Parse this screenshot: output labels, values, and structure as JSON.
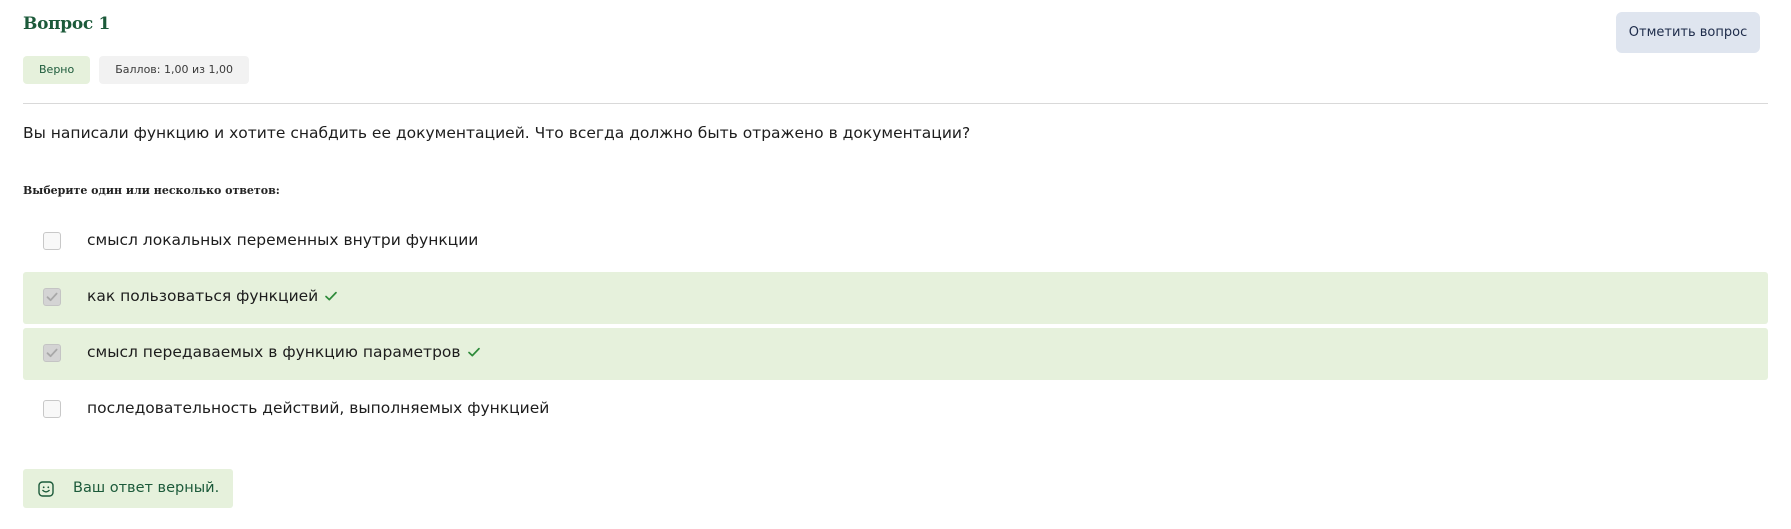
{
  "question": {
    "title": "Вопрос 1",
    "flag_label": "Отметить вопрос",
    "status_badge": "Верно",
    "score_badge": "Баллов: 1,00 из 1,00",
    "text": "Вы написали функцию и хотите снабдить ее документацией. Что всегда должно быть отражено в документации?",
    "prompt": "Выберите один или несколько ответов:"
  },
  "answers": [
    {
      "label": "смысл локальных переменных внутри функции",
      "checked": false,
      "correct_mark": false
    },
    {
      "label": "как пользоваться функцией",
      "checked": true,
      "correct_mark": true
    },
    {
      "label": "смысл передаваемых в функцию параметров",
      "checked": true,
      "correct_mark": true
    },
    {
      "label": "последовательность действий, выполняемых функцией",
      "checked": false,
      "correct_mark": false
    }
  ],
  "feedback": {
    "text": "Ваш ответ верный.",
    "icon": "smile-icon"
  },
  "colors": {
    "accent_green": "#1c5a3a",
    "correct_bg": "#e6f1dc",
    "check_green": "#2e8b3a",
    "flag_bg": "#dfe5ef"
  }
}
